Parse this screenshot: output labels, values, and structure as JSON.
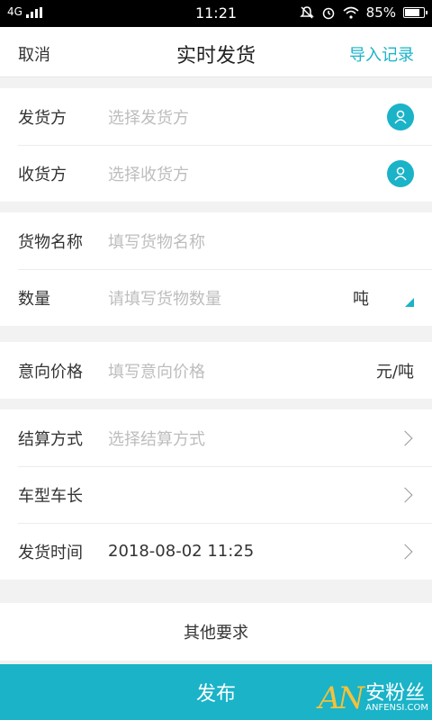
{
  "status_bar": {
    "network": "4G",
    "time": "11:21",
    "battery": "85%",
    "battery_level": 0.85
  },
  "header": {
    "cancel": "取消",
    "title": "实时发货",
    "import": "导入记录"
  },
  "section1": [
    {
      "label": "发货方",
      "placeholder": "选择发货方"
    },
    {
      "label": "收货方",
      "placeholder": "选择收货方"
    }
  ],
  "section2": [
    {
      "label": "货物名称",
      "placeholder": "填写货物名称"
    },
    {
      "label": "数量",
      "placeholder": "请填写货物数量",
      "unit": "吨"
    }
  ],
  "section3": [
    {
      "label": "意向价格",
      "placeholder": "填写意向价格",
      "unit": "元/吨"
    }
  ],
  "section4": [
    {
      "label": "结算方式",
      "placeholder": "选择结算方式"
    },
    {
      "label": "车型车长",
      "placeholder": ""
    },
    {
      "label": "发货时间",
      "value": "2018-08-02 11:25"
    }
  ],
  "other": "其他要求",
  "publish": "发布",
  "watermark": {
    "big": "AN",
    "cn": "安粉丝",
    "en": "ANFENSI.COM"
  },
  "colors": {
    "accent": "#1ab3c8"
  }
}
